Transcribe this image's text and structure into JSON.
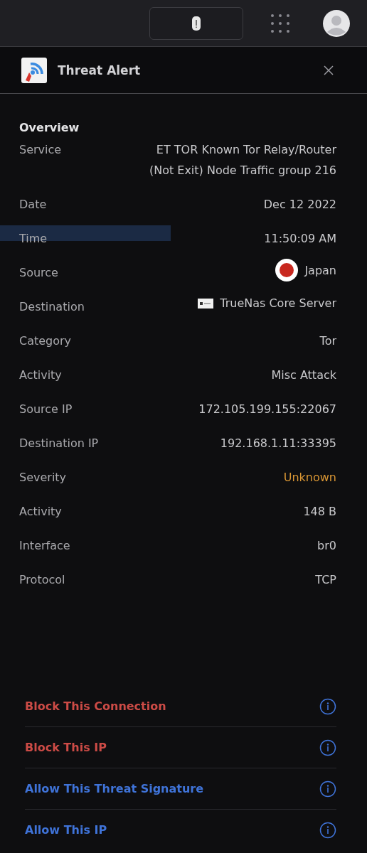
{
  "top_bar": {
    "alert_button": {
      "selected": false
    }
  },
  "dialog": {
    "title": "Threat Alert"
  },
  "overview": {
    "heading": "Overview",
    "rows": [
      {
        "label": "Service",
        "value": "ET TOR Known Tor Relay/Router (Not Exit) Node Traffic group 216",
        "kind": "text",
        "highlighted": false
      },
      {
        "label": "Date",
        "value": "Dec 12 2022",
        "kind": "text",
        "highlighted": false
      },
      {
        "label": "Time",
        "value": "11:50:09 AM",
        "kind": "text",
        "highlighted": true
      },
      {
        "label": "Source",
        "value": "Japan",
        "kind": "flag",
        "highlighted": false
      },
      {
        "label": "Destination",
        "value": "TrueNas Core Server",
        "kind": "device",
        "highlighted": false
      },
      {
        "label": "Category",
        "value": "Tor",
        "kind": "text",
        "highlighted": false
      },
      {
        "label": "Activity",
        "value": "Misc Attack",
        "kind": "text",
        "highlighted": false
      },
      {
        "label": "Source IP",
        "value": "172.105.199.155:22067",
        "kind": "text",
        "highlighted": false
      },
      {
        "label": "Destination IP",
        "value": "192.168.1.11:33395",
        "kind": "text",
        "highlighted": false
      },
      {
        "label": "Severity",
        "value": "Unknown",
        "kind": "warning",
        "highlighted": false
      },
      {
        "label": "Activity",
        "value": "148 B",
        "kind": "text",
        "highlighted": false
      },
      {
        "label": "Interface",
        "value": "br0",
        "kind": "text",
        "highlighted": false
      },
      {
        "label": "Protocol",
        "value": "TCP",
        "kind": "text",
        "highlighted": false
      }
    ]
  },
  "actions": [
    {
      "label": "Block This Connection",
      "kind": "block"
    },
    {
      "label": "Block This IP",
      "kind": "block"
    },
    {
      "label": "Allow This Threat Signature",
      "kind": "allow"
    },
    {
      "label": "Allow This IP",
      "kind": "allow"
    }
  ]
}
